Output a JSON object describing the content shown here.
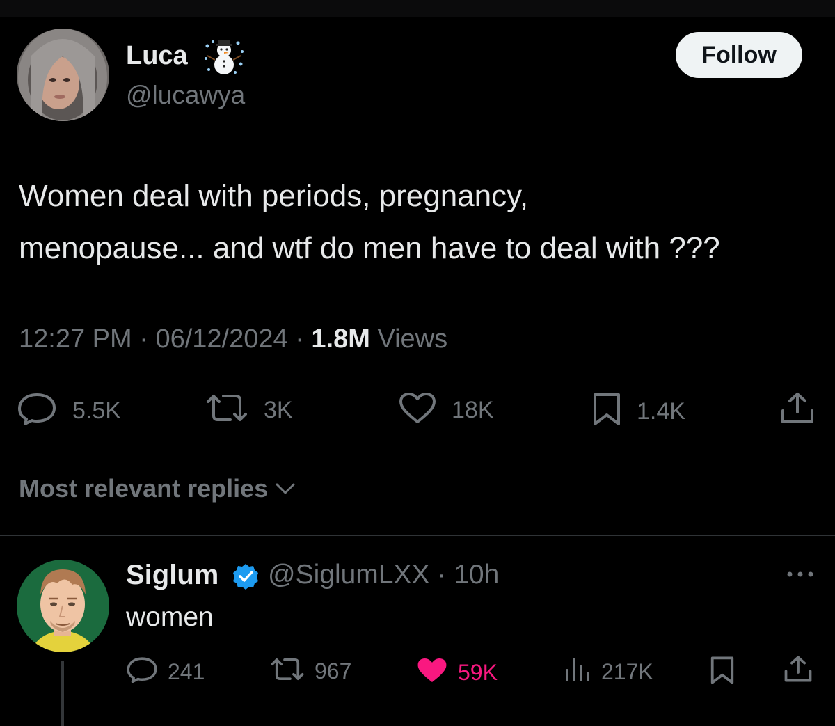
{
  "theme": {
    "background": "#000000",
    "text": "#e7e9ea",
    "muted": "#71767b",
    "like_active": "#f91880",
    "verified": "#1d9bf0",
    "follow_bg": "#eff3f4"
  },
  "tweet": {
    "author_name": "Luca",
    "name_emoji": "snowman-icon",
    "author_handle": "@lucawya",
    "follow_label": "Follow",
    "text_lines": [
      "Women deal with periods, pregnancy,",
      "menopause... and wtf do men have to deal with ???"
    ],
    "time": "12:27 PM",
    "date": "06/12/2024",
    "views_count": "1.8M",
    "views_label": "Views",
    "actions": {
      "replies": "5.5K",
      "reposts": "3K",
      "likes": "18K",
      "bookmarks": "1.4K"
    }
  },
  "replies_sort_label": "Most relevant replies",
  "reply": {
    "author_name": "Siglum",
    "verified": true,
    "handle": "@SiglumLXX",
    "age": "10h",
    "text": "women",
    "actions": {
      "replies": "241",
      "reposts": "967",
      "likes": "59K",
      "views": "217K"
    }
  }
}
